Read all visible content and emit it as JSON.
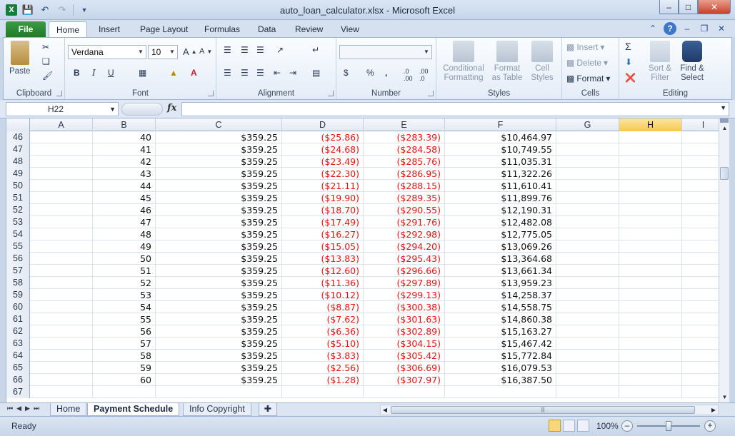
{
  "window": {
    "title": "auto_loan_calculator.xlsx - Microsoft Excel",
    "app_icon": "X"
  },
  "ribbon_tabs": [
    "File",
    "Home",
    "Insert",
    "Page Layout",
    "Formulas",
    "Data",
    "Review",
    "View"
  ],
  "active_tab": "Home",
  "ribbon": {
    "clipboard": {
      "label": "Clipboard",
      "paste": "Paste"
    },
    "font": {
      "label": "Font",
      "font_name": "Verdana",
      "font_size": "10",
      "bold": "B",
      "italic": "I",
      "underline": "U"
    },
    "alignment": {
      "label": "Alignment"
    },
    "number": {
      "label": "Number",
      "format": "",
      "currency": "$",
      "percent": "%",
      "comma": ","
    },
    "styles": {
      "label": "Styles",
      "conditional": "Conditional Formatting",
      "as_table": "Format as Table",
      "cell_styles": "Cell Styles"
    },
    "cells": {
      "label": "Cells",
      "insert": "Insert",
      "delete": "Delete",
      "format": "Format"
    },
    "editing": {
      "label": "Editing",
      "sort_filter": "Sort & Filter",
      "find_select": "Find & Select",
      "sigma": "Σ"
    }
  },
  "formula_bar": {
    "name_box": "H22",
    "fx": "fx",
    "formula": ""
  },
  "columns": [
    "A",
    "B",
    "C",
    "D",
    "E",
    "F",
    "G",
    "H",
    "I"
  ],
  "selected_column": "H",
  "rows": [
    {
      "n": "46",
      "b": "40",
      "c": "$359.25",
      "d": "($25.86)",
      "e": "($283.39)",
      "f": "$10,464.97"
    },
    {
      "n": "47",
      "b": "41",
      "c": "$359.25",
      "d": "($24.68)",
      "e": "($284.58)",
      "f": "$10,749.55"
    },
    {
      "n": "48",
      "b": "42",
      "c": "$359.25",
      "d": "($23.49)",
      "e": "($285.76)",
      "f": "$11,035.31"
    },
    {
      "n": "49",
      "b": "43",
      "c": "$359.25",
      "d": "($22.30)",
      "e": "($286.95)",
      "f": "$11,322.26"
    },
    {
      "n": "50",
      "b": "44",
      "c": "$359.25",
      "d": "($21.11)",
      "e": "($288.15)",
      "f": "$11,610.41"
    },
    {
      "n": "51",
      "b": "45",
      "c": "$359.25",
      "d": "($19.90)",
      "e": "($289.35)",
      "f": "$11,899.76"
    },
    {
      "n": "52",
      "b": "46",
      "c": "$359.25",
      "d": "($18.70)",
      "e": "($290.55)",
      "f": "$12,190.31"
    },
    {
      "n": "53",
      "b": "47",
      "c": "$359.25",
      "d": "($17.49)",
      "e": "($291.76)",
      "f": "$12,482.08"
    },
    {
      "n": "54",
      "b": "48",
      "c": "$359.25",
      "d": "($16.27)",
      "e": "($292.98)",
      "f": "$12,775.05"
    },
    {
      "n": "55",
      "b": "49",
      "c": "$359.25",
      "d": "($15.05)",
      "e": "($294.20)",
      "f": "$13,069.26"
    },
    {
      "n": "56",
      "b": "50",
      "c": "$359.25",
      "d": "($13.83)",
      "e": "($295.43)",
      "f": "$13,364.68"
    },
    {
      "n": "57",
      "b": "51",
      "c": "$359.25",
      "d": "($12.60)",
      "e": "($296.66)",
      "f": "$13,661.34"
    },
    {
      "n": "58",
      "b": "52",
      "c": "$359.25",
      "d": "($11.36)",
      "e": "($297.89)",
      "f": "$13,959.23"
    },
    {
      "n": "59",
      "b": "53",
      "c": "$359.25",
      "d": "($10.12)",
      "e": "($299.13)",
      "f": "$14,258.37"
    },
    {
      "n": "60",
      "b": "54",
      "c": "$359.25",
      "d": "($8.87)",
      "e": "($300.38)",
      "f": "$14,558.75"
    },
    {
      "n": "61",
      "b": "55",
      "c": "$359.25",
      "d": "($7.62)",
      "e": "($301.63)",
      "f": "$14,860.38"
    },
    {
      "n": "62",
      "b": "56",
      "c": "$359.25",
      "d": "($6.36)",
      "e": "($302.89)",
      "f": "$15,163.27"
    },
    {
      "n": "63",
      "b": "57",
      "c": "$359.25",
      "d": "($5.10)",
      "e": "($304.15)",
      "f": "$15,467.42"
    },
    {
      "n": "64",
      "b": "58",
      "c": "$359.25",
      "d": "($3.83)",
      "e": "($305.42)",
      "f": "$15,772.84"
    },
    {
      "n": "65",
      "b": "59",
      "c": "$359.25",
      "d": "($2.56)",
      "e": "($306.69)",
      "f": "$16,079.53"
    },
    {
      "n": "66",
      "b": "60",
      "c": "$359.25",
      "d": "($1.28)",
      "e": "($307.97)",
      "f": "$16,387.50"
    },
    {
      "n": "67",
      "b": "",
      "c": "",
      "d": "",
      "e": "",
      "f": ""
    }
  ],
  "sheet_tabs": [
    "Home",
    "Payment Schedule",
    "Info Copyright"
  ],
  "active_sheet": "Payment Schedule",
  "status": {
    "text": "Ready",
    "zoom": "100%"
  },
  "colors": {
    "negative": "#ee1111",
    "file_tab": "#2a8a35",
    "selected_header": "#f5c94e"
  }
}
